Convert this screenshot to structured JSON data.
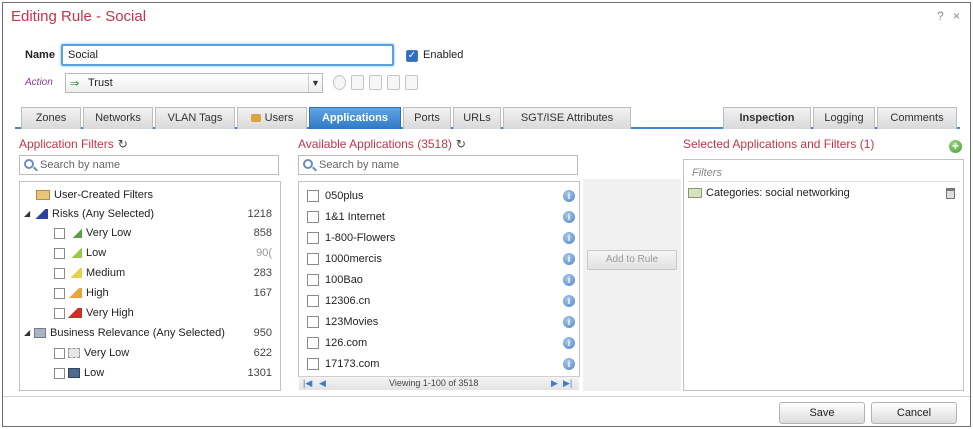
{
  "dialog": {
    "title": "Editing Rule - Social",
    "help_label": "?",
    "close_label": "×"
  },
  "form": {
    "name_label": "Name",
    "name_value": "Social",
    "enabled_label": "Enabled",
    "enabled_checked": true,
    "action_label": "Action",
    "action_value": "Trust"
  },
  "tabs_left": [
    {
      "label": "Zones"
    },
    {
      "label": "Networks"
    },
    {
      "label": "VLAN Tags"
    },
    {
      "label": "Users"
    },
    {
      "label": "Applications",
      "active": true
    },
    {
      "label": "Ports"
    },
    {
      "label": "URLs"
    },
    {
      "label": "SGT/ISE Attributes"
    }
  ],
  "tabs_right": [
    {
      "label": "Inspection"
    },
    {
      "label": "Logging"
    },
    {
      "label": "Comments"
    }
  ],
  "app_filters": {
    "title": "Application Filters",
    "search_placeholder": "Search by name",
    "items": [
      {
        "label": "User-Created Filters",
        "count": ""
      },
      {
        "label": "Risks (Any Selected)",
        "count": "1218"
      },
      {
        "label": "Very Low",
        "count": "858"
      },
      {
        "label": "Low",
        "count": "90("
      },
      {
        "label": "Medium",
        "count": "283"
      },
      {
        "label": "High",
        "count": "167"
      },
      {
        "label": "Very High",
        "count": ""
      },
      {
        "label": "Business Relevance (Any Selected)",
        "count": "950"
      },
      {
        "label": "Very Low",
        "count": "622"
      },
      {
        "label": "Low",
        "count": "1301"
      }
    ]
  },
  "available_apps": {
    "title": "Available Applications (3518)",
    "search_placeholder": "Search by name",
    "items": [
      "050plus",
      "1&1 Internet",
      "1-800-Flowers",
      "1000mercis",
      "100Bao",
      "12306.cn",
      "123Movies",
      "126.com",
      "17173.com"
    ],
    "pager_text": "Viewing 1-100 of 3518"
  },
  "add_to_rule_label": "Add to Rule",
  "selected": {
    "title": "Selected Applications and Filters (1)",
    "filters_placeholder": "Filters",
    "items": [
      "Categories: social networking"
    ]
  },
  "footer": {
    "save_label": "Save",
    "cancel_label": "Cancel"
  },
  "colors": {
    "title_red": "#c4344c",
    "tab_active_blue": "#2f78c4"
  }
}
